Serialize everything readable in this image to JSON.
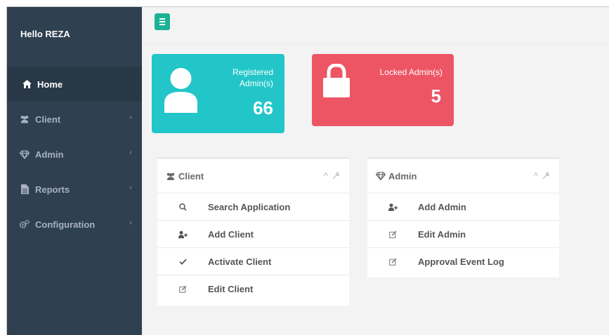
{
  "sidebar": {
    "greeting": "Hello REZA",
    "items": [
      {
        "label": "Home",
        "icon": "home-icon",
        "active": true
      },
      {
        "label": "Client",
        "icon": "users-icon"
      },
      {
        "label": "Admin",
        "icon": "diamond-icon"
      },
      {
        "label": "Reports",
        "icon": "file-icon"
      },
      {
        "label": "Configuration",
        "icon": "cogs-icon"
      }
    ],
    "chevron": "‹"
  },
  "topbar": {
    "menu_icon": "hamburger-icon",
    "menu_color": "#1ab394"
  },
  "widgets": {
    "registered": {
      "label": "Registered Admin(s)",
      "value": "66",
      "color": "#23c6c8",
      "icon": "user-icon"
    },
    "locked": {
      "label": "Locked Admin(s)",
      "value": "5",
      "color": "#ed5565",
      "icon": "lock-icon"
    }
  },
  "client_panel": {
    "title": "Client",
    "rows": [
      {
        "label": "Search Application",
        "icon": "search-icon"
      },
      {
        "label": "Add Client",
        "icon": "user-plus-icon"
      },
      {
        "label": "Activate Client",
        "icon": "check-icon"
      },
      {
        "label": "Edit Client",
        "icon": "edit-icon"
      }
    ]
  },
  "admin_panel": {
    "title": "Admin",
    "rows": [
      {
        "label": "Add Admin",
        "icon": "user-plus-icon"
      },
      {
        "label": "Edit Admin",
        "icon": "edit-icon"
      },
      {
        "label": "Approval Event Log",
        "icon": "edit-icon"
      }
    ]
  }
}
